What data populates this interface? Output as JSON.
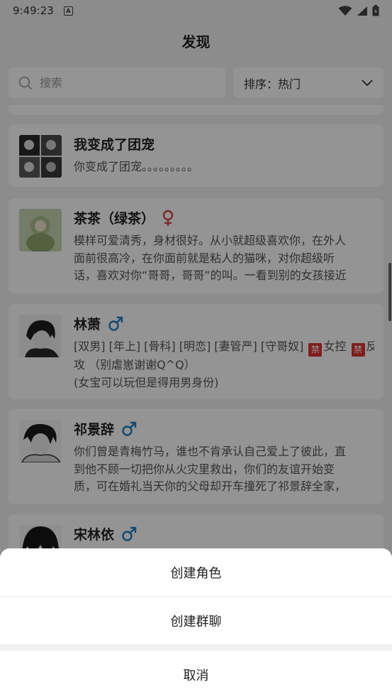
{
  "status_bar": {
    "time": "9:49:23",
    "notification_icon": "A",
    "icons": [
      "wifi-icon",
      "signal-icon",
      "battery-icon"
    ]
  },
  "header": {
    "title": "发现"
  },
  "search": {
    "placeholder": "搜索"
  },
  "sort": {
    "label": "排序：热门"
  },
  "cards": [
    {
      "name": "我变成了团宠",
      "gender": "",
      "desc_lines": [
        "你变成了团宠。。。。。。。。。"
      ]
    },
    {
      "name": "茶茶（绿茶）",
      "gender": "female",
      "gender_color": "#d24a4a",
      "desc_lines": [
        "模样可爱清秀，身材很好。从小就超级喜欢你，在外人",
        "面前很高冷，在你面前就是粘人的猫咪，对你超级听",
        "话，喜欢对你“哥哥，哥哥”的叫。一看到别的女孩接近"
      ]
    },
    {
      "name": "林萧",
      "gender": "male",
      "gender_color": "#1e7fc7",
      "desc_line1_a": "[双男] [年上] [骨科] [明恋] [妻管严] [守哥奴]",
      "desc_ban1": "禁",
      "desc_line1_b": "女控",
      "desc_ban2": "禁",
      "desc_line1_c": "反",
      "desc_line2": "攻 （别虐崽谢谢Q^Q）",
      "desc_line3": "(女宝可以玩但是得用男身份)"
    },
    {
      "name": "祁景辞",
      "gender": "male",
      "gender_color": "#1e7fc7",
      "desc_lines": [
        "你们曾是青梅竹马，谁也不肯承认自己爱上了彼此，直",
        "到他不顾一切把你从火灾里救出，你们的友谊开始变",
        "质，可在婚礼当天你的父母却开车撞死了祁景辞全家，"
      ]
    },
    {
      "name": "宋林依",
      "gender": "male",
      "gender_color": "#1e7fc7",
      "desc_lines": []
    }
  ],
  "action_sheet": {
    "create_role": "创建角色",
    "create_group": "创建群聊",
    "cancel": "取消"
  }
}
